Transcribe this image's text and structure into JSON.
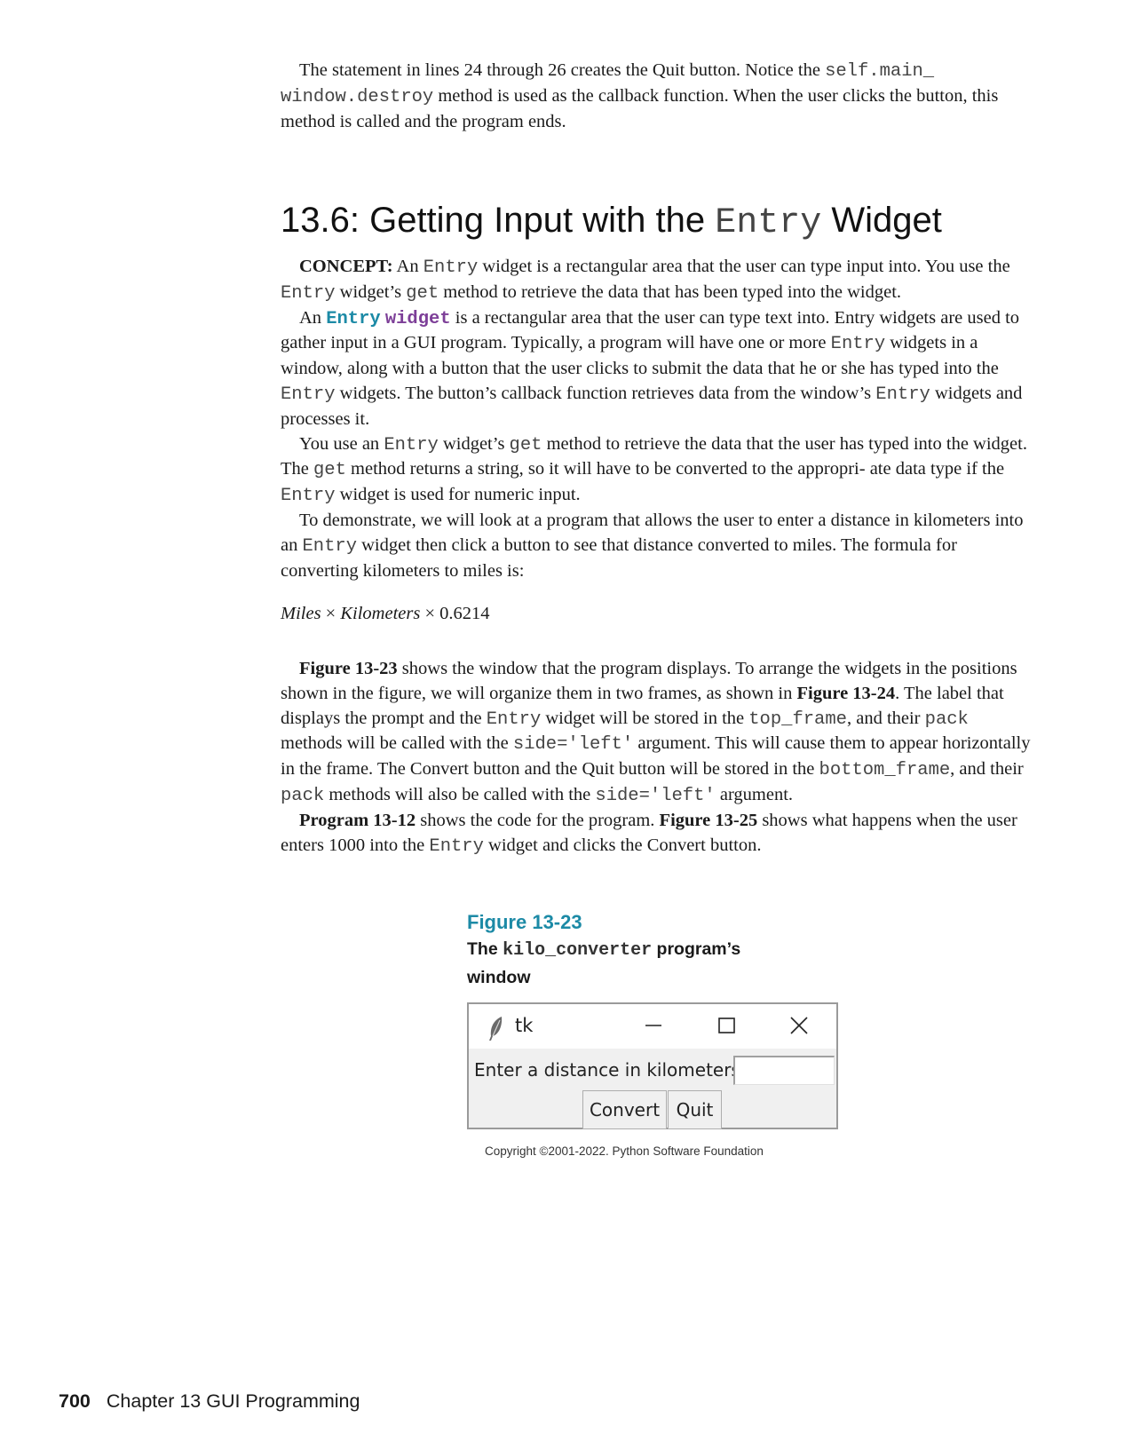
{
  "intro": {
    "t1": "The statement in lines 24 through 26 creates the Quit button. Notice the ",
    "code1": "self.main_ window.destroy",
    "t2": " method is used as the callback function. When the user clicks the button, this method is called and the program ends."
  },
  "section": {
    "number_title": "13.6: Getting Input with the ",
    "code": "Entry",
    "title_end": " Widget"
  },
  "concept": {
    "label": "CONCEPT:",
    "t1": " An ",
    "c1": "Entry",
    "t2": " widget is a rectangular area that the user can type input into. You use the ",
    "c2": "Entry",
    "t3": " widget’s ",
    "c3": "get",
    "t4": " method to retrieve the data that has been typed into the widget."
  },
  "para1": {
    "t1": "An ",
    "kw1": "Entry",
    "kw2": "widget",
    "t2": " is a rectangular area that the user can type text into. Entry widgets are used to gather input in a GUI program. Typically, a program will have one or more ",
    "c1": "Entry",
    "t3": " widgets in a window, along with a button that the user clicks to submit the data that he or she has typed into the ",
    "c2": "Entry",
    "t4": " widgets. The button’s callback function retrieves data from the window’s ",
    "c3": "Entry",
    "t5": " widgets and processes it."
  },
  "para2": {
    "t1": "You use an ",
    "c1": "Entry",
    "t2": " widget’s ",
    "c2": "get",
    "t3": " method to retrieve the data that the user has typed into the widget. The ",
    "c3": "get",
    "t4": " method returns a string, so it will have to be converted to the appropri- ate data type if the ",
    "c4": "Entry",
    "t5": " widget is used for numeric input."
  },
  "para3": {
    "t1": "To demonstrate, we will look at a program that allows the user to enter a distance in kilometers into an ",
    "c1": "Entry",
    "t2": " widget then click a button to see that distance converted to miles. The formula for converting kilometers to miles is:"
  },
  "formula": {
    "miles": "Miles",
    "x1": " × ",
    "km": "Kilometers",
    "x2": " × 0.6214"
  },
  "para4": {
    "ref1": "Figure 13-23",
    "t1": " shows the window that the program displays. To arrange the widgets in the positions shown in the figure, we will organize them in two frames, as shown in ",
    "ref2": "Figure 13-24",
    "t2": ". The label that displays the prompt and the ",
    "c1": "Entry",
    "t3": " widget will be stored in the ",
    "c2": "top_frame",
    "t4": ", and their ",
    "c3": "pack",
    "t5": " methods will be called with the ",
    "c4": "side='left'",
    "t6": " argument. This will cause them to appear horizontally in the frame. The Convert button and the Quit button will be stored in the ",
    "c5": "bottom_frame",
    "t7": ", and their ",
    "c6": "pack",
    "t8": " methods will also be called with the ",
    "c7": "side='left'",
    "t9": " argument."
  },
  "para5": {
    "ref1": "Program 13-12",
    "t1": " shows the code for the program. ",
    "ref2": "Figure 13-25",
    "t2": " shows what happens when the user enters 1000 into the ",
    "c1": "Entry",
    "t3": " widget and clicks the Convert button."
  },
  "figure": {
    "number": "Figure 13-23",
    "cap_the": "The ",
    "cap_code": "kilo_converter",
    "cap_rest": " program’s window",
    "window": {
      "title": "tk",
      "prompt": "Enter a distance in kilometers:",
      "entry_value": "",
      "convert_label": "Convert",
      "quit_label": "Quit"
    },
    "copyright": "Copyright ©2001-2022. Python Software Foundation"
  },
  "footer": {
    "page_number": "700",
    "chapter": "Chapter 13 GUI Programming"
  }
}
